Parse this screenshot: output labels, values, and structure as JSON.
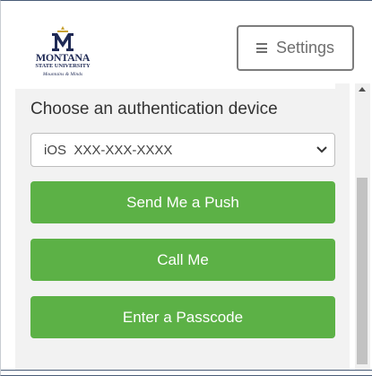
{
  "logo": {
    "name": "MONTANA",
    "university": "STATE UNIVERSITY",
    "tagline": "Mountains & Minds",
    "colors": {
      "navy": "#1f2a55",
      "gold": "#c8a232"
    }
  },
  "header": {
    "settings_label": "Settings",
    "settings_icon": "hamburger-menu-icon"
  },
  "auth": {
    "prompt": "Choose an authentication device",
    "device_value": "iOS  XXX-XXX-XXXX",
    "buttons": {
      "push": "Send Me a Push",
      "call": "Call Me",
      "passcode": "Enter a Passcode"
    }
  },
  "colors": {
    "button_green": "#5cb146",
    "panel_bg": "#f2f2f2"
  }
}
